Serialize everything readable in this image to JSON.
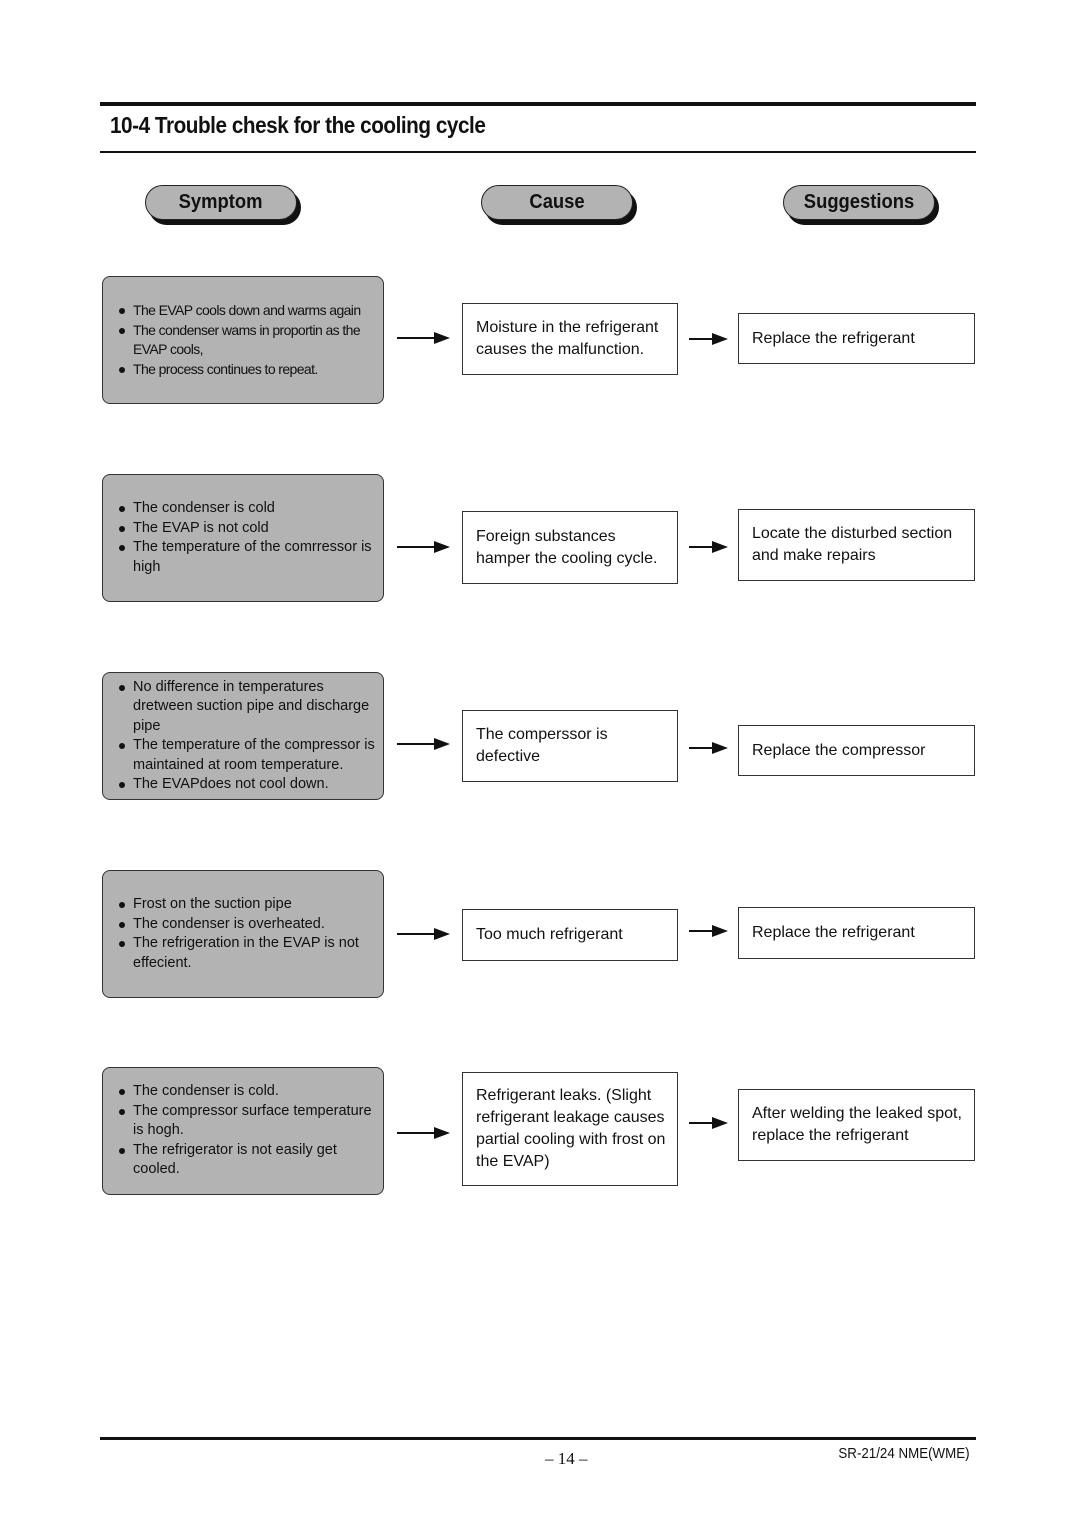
{
  "header": {
    "title": "10-4 Trouble chesk for the cooling cycle"
  },
  "columns": {
    "symptom": "Symptom",
    "cause": "Cause",
    "suggestions": "Suggestions"
  },
  "rows": [
    {
      "symptoms": [
        "The EVAP cools down and warms again",
        "The condenser wams in proportin as the EVAP cools,",
        "The process continues to repeat."
      ],
      "cause": "Moisture in the refrigerant causes the malfunction.",
      "suggestion": "Replace the refrigerant"
    },
    {
      "symptoms": [
        "The condenser is cold",
        "The EVAP is not cold",
        "The temperature of the comrressor is high"
      ],
      "cause": "Foreign substances hamper the cooling cycle.",
      "suggestion": "Locate the disturbed section and make repairs"
    },
    {
      "symptoms": [
        "No difference in temperatures dretween suction pipe and discharge pipe",
        "The temperature of the compressor is maintained at room temperature.",
        "The EVAPdoes not cool down."
      ],
      "cause": "The comperssor is defective",
      "suggestion": "Replace the compressor"
    },
    {
      "symptoms": [
        "Frost on the suction pipe",
        "The condenser is overheated.",
        "The refrigeration in the EVAP is not effecient."
      ],
      "cause": "Too much refrigerant",
      "suggestion": "Replace the refrigerant"
    },
    {
      "symptoms": [
        "The condenser is cold.",
        "The compressor surface temperature is hogh.",
        "The refrigerator is not easily get cooled."
      ],
      "cause": "Refrigerant leaks. (Slight refrigerant leakage causes partial cooling with frost on the EVAP)",
      "suggestion": "After welding the leaked spot, replace the refrigerant"
    }
  ],
  "footer": {
    "page_number": "– 14 –",
    "model": "SR-21/24 NME(WME)"
  }
}
